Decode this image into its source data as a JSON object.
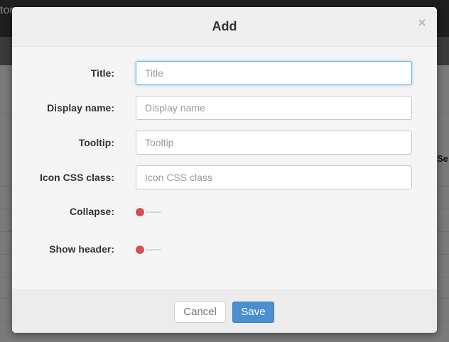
{
  "background": {
    "topbar_text": "tor",
    "right_text": "Se"
  },
  "modal": {
    "title": "Add",
    "close_symbol": "×",
    "fields": [
      {
        "label": "Title:",
        "placeholder": "Title",
        "value": ""
      },
      {
        "label": "Display name:",
        "placeholder": "Display name",
        "value": ""
      },
      {
        "label": "Tooltip:",
        "placeholder": "Tooltip",
        "value": ""
      },
      {
        "label": "Icon CSS class:",
        "placeholder": "Icon CSS class",
        "value": ""
      }
    ],
    "toggles": [
      {
        "label": "Collapse:",
        "state": "off"
      },
      {
        "label": "Show header:",
        "state": "off"
      }
    ],
    "footer": {
      "cancel_label": "Cancel",
      "save_label": "Save"
    }
  },
  "colors": {
    "primary": "#4a8fd1",
    "toggle_off": "#d64f55",
    "focus_ring": "#66afe9"
  }
}
